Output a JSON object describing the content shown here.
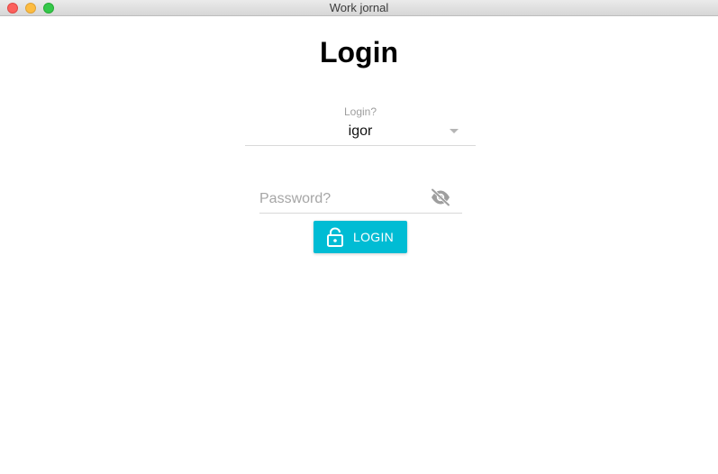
{
  "window": {
    "title": "Work jornal"
  },
  "page": {
    "title": "Login"
  },
  "login_select": {
    "label": "Login?",
    "value": "igor"
  },
  "password_field": {
    "placeholder": "Password?",
    "value": "",
    "visibility_icon": "eye-off-icon"
  },
  "login_button": {
    "label": "LOGIN",
    "icon": "lock-open-icon",
    "color": "#00bcd4"
  },
  "colors": {
    "accent": "#00bcd4",
    "close": "#fc605c",
    "minimize": "#fdbc40",
    "maximize": "#34c84a"
  }
}
